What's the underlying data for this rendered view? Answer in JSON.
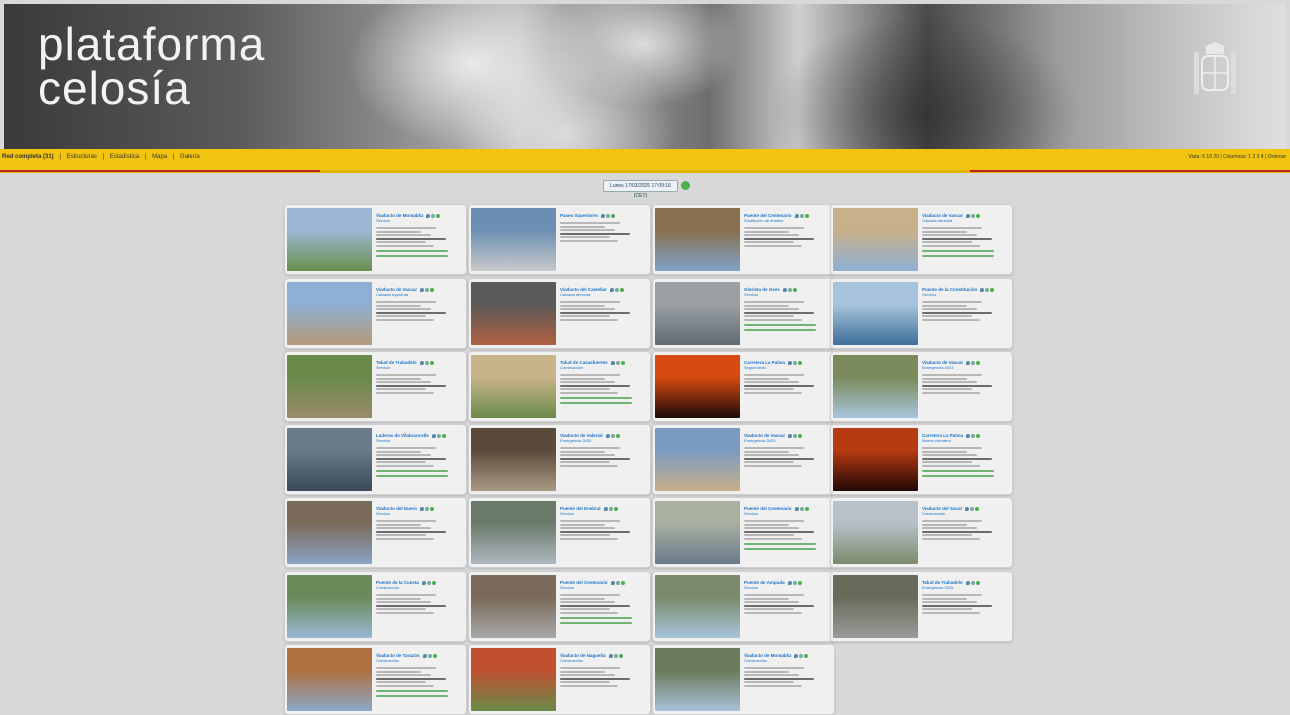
{
  "brand": {
    "line1": "plataforma",
    "line2": "celosía"
  },
  "nav": {
    "items": [
      "Red completa (31)",
      "|",
      "Estructuras",
      "|",
      "Estadística",
      "|",
      "Mapa",
      "|",
      "Galería"
    ],
    "right": "Vista: 5 10 20 | Columnas: 1 2 3 4 | Ordenar"
  },
  "date": "Lunes 17/03/2025 17:09:16 (CET)",
  "colors": {
    "nav": "#f1c40f",
    "accent_red": "#b22222",
    "link": "#1a73c8",
    "status_ok": "#4caf50"
  },
  "cards": [
    {
      "title": "Viaducto de Montabliz",
      "sub": "Servicio",
      "thumb": [
        "#6a8f4e",
        "#9bb7d4"
      ]
    },
    {
      "title": "Paseo Superiores",
      "sub": "",
      "thumb": [
        "#c9c9c9",
        "#6b8fb3"
      ]
    },
    {
      "title": "Puente del Centenario",
      "sub": "Sustitución de tirantes",
      "thumb": [
        "#7fa3c9",
        "#8a6f4f"
      ]
    },
    {
      "title": "Viaducto de Vascar",
      "sub": "Calzada derecha",
      "thumb": [
        "#8fb0d4",
        "#c8b08a"
      ]
    },
    {
      "title": "Viaducto de Vascar",
      "sub": "Calzada izquierda",
      "thumb": [
        "#b49a7a",
        "#8fb0d4"
      ]
    },
    {
      "title": "Viaducto del Castellar",
      "sub": "Calzada derecha",
      "thumb": [
        "#b06040",
        "#5a5a5a"
      ]
    },
    {
      "title": "Glorieta de Oses",
      "sub": "Servicio",
      "thumb": [
        "#5f6a72",
        "#9aa0a4"
      ]
    },
    {
      "title": "Puente de la Constitución",
      "sub": "Servicio",
      "thumb": [
        "#3d6e9a",
        "#a8c4dc"
      ]
    },
    {
      "title": "Talud de Trabadelo",
      "sub": "Servicio",
      "thumb": [
        "#9a8a6a",
        "#6a8a4a"
      ]
    },
    {
      "title": "Talud de Casasfuertes",
      "sub": "Construcción",
      "thumb": [
        "#6a8a4a",
        "#c8b48a"
      ]
    },
    {
      "title": "Carretera La Palma",
      "sub": "Seguimiento",
      "thumb": [
        "#1a0a08",
        "#d84a10"
      ]
    },
    {
      "title": "Viaducto de Vascar",
      "sub": "Emergencia 2023",
      "thumb": [
        "#a8c4dc",
        "#7a8a5a"
      ]
    },
    {
      "title": "Laderas de Vilabrancelle",
      "sub": "Servicio",
      "thumb": [
        "#3a4a5a",
        "#6a7a8a"
      ]
    },
    {
      "title": "Viaducto de Valerad",
      "sub": "Emergencia 2025",
      "thumb": [
        "#a89a84",
        "#5a4a3a"
      ]
    },
    {
      "title": "Viaducto de Vascar",
      "sub": "Emergencia 2023",
      "thumb": [
        "#c8b08a",
        "#7a9ac0"
      ]
    },
    {
      "title": "Carretera La Palma",
      "sub": "Nueva carretera",
      "thumb": [
        "#200806",
        "#b83a10"
      ]
    },
    {
      "title": "Viaducto del Duero",
      "sub": "Servicio",
      "thumb": [
        "#8aa4c4",
        "#7a6a5a"
      ]
    },
    {
      "title": "Puente del Enebral",
      "sub": "Servicio",
      "thumb": [
        "#b0b8c0",
        "#6a7a6a"
      ]
    },
    {
      "title": "Puente del Centenario",
      "sub": "Servicio",
      "thumb": [
        "#6a7a8a",
        "#a8b0a0"
      ]
    },
    {
      "title": "Viaducto del Sacol",
      "sub": "Construcción",
      "thumb": [
        "#7a8a6a",
        "#b8c0c8"
      ]
    },
    {
      "title": "Puente de la Cuesta",
      "sub": "Construcción",
      "thumb": [
        "#9ab8d4",
        "#6a8a5a"
      ]
    },
    {
      "title": "Puente del Centenario",
      "sub": "Servicio",
      "thumb": [
        "#a8a8a8",
        "#7a6a5a"
      ]
    },
    {
      "title": "Puente de Ampuda",
      "sub": "Servicio",
      "thumb": [
        "#a8c4dc",
        "#7a8a6a"
      ]
    },
    {
      "title": "Talud de Trabadelo",
      "sub": "Emergencia 2025",
      "thumb": [
        "#9a9a9a",
        "#6a6a5a"
      ]
    },
    {
      "title": "Viaducto de Tarazón",
      "sub": "Construcción",
      "thumb": [
        "#8aa8c8",
        "#b07040"
      ]
    },
    {
      "title": "Viaducto de Nagueña",
      "sub": "Construcción",
      "thumb": [
        "#6a8a4a",
        "#c05030"
      ]
    },
    {
      "title": "Viaducto de Montabliz",
      "sub": "Construcción",
      "thumb": [
        "#a8c0d8",
        "#6a7a5a"
      ]
    }
  ]
}
